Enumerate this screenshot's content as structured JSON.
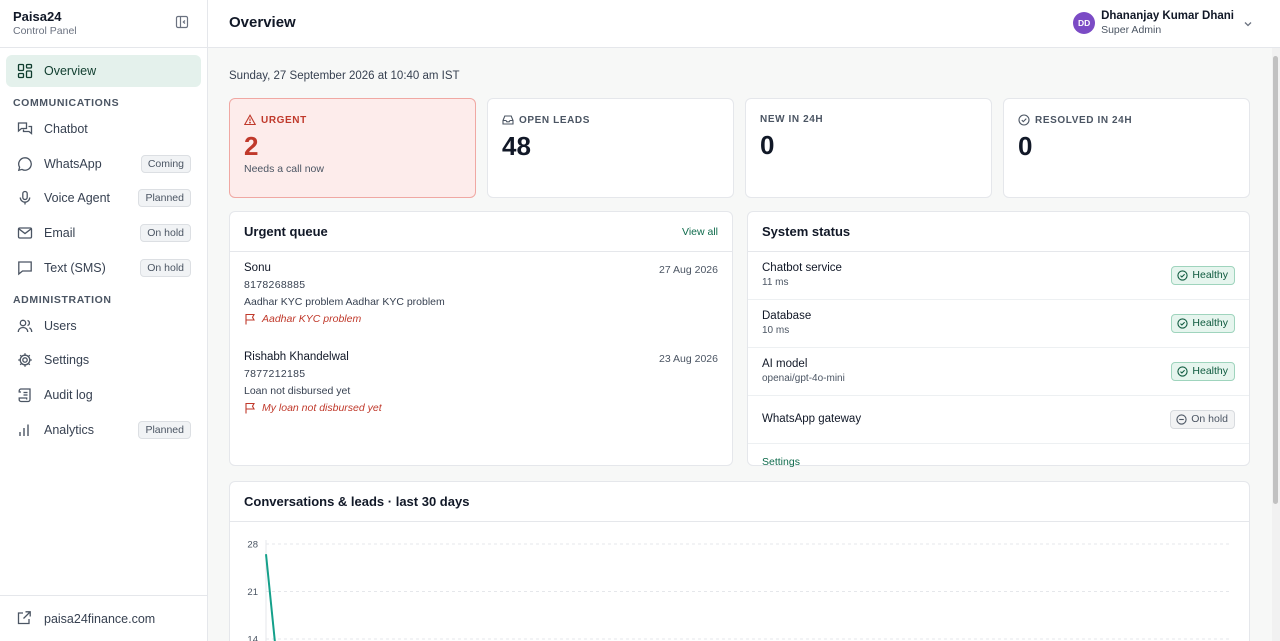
{
  "brand": {
    "name": "Paisa24",
    "subtitle": "Control Panel"
  },
  "sidebar": {
    "overview": "Overview",
    "sections": {
      "communications": "COMMUNICATIONS",
      "administration": "ADMINISTRATION"
    },
    "comm_items": [
      {
        "label": "Chatbot",
        "pill": ""
      },
      {
        "label": "WhatsApp",
        "pill": "Coming"
      },
      {
        "label": "Voice Agent",
        "pill": "Planned"
      },
      {
        "label": "Email",
        "pill": "On hold"
      },
      {
        "label": "Text (SMS)",
        "pill": "On hold"
      }
    ],
    "admin_items": [
      {
        "label": "Users",
        "pill": ""
      },
      {
        "label": "Settings",
        "pill": ""
      },
      {
        "label": "Audit log",
        "pill": ""
      },
      {
        "label": "Analytics",
        "pill": "Planned"
      }
    ],
    "footer_link": "paisa24finance.com"
  },
  "header": {
    "title": "Overview",
    "user": {
      "initials": "DD",
      "name": "Dhananjay Kumar Dhani",
      "role": "Super Admin"
    }
  },
  "date_line": "Sunday, 27 September 2026 at 10:40 am IST",
  "stats": [
    {
      "label": "URGENT",
      "value": "2",
      "sub": "Needs a call now"
    },
    {
      "label": "OPEN LEADS",
      "value": "48",
      "sub": ""
    },
    {
      "label": "NEW IN 24H",
      "value": "0",
      "sub": ""
    },
    {
      "label": "RESOLVED IN 24H",
      "value": "0",
      "sub": ""
    }
  ],
  "urgent_queue": {
    "title": "Urgent queue",
    "view_all": "View all",
    "items": [
      {
        "name": "Sonu",
        "date": "27 Aug 2026",
        "phone": "8178268885",
        "message": "Aadhar KYC problem Aadhar KYC problem",
        "flag": "Aadhar KYC problem"
      },
      {
        "name": "Rishabh Khandelwal",
        "date": "23 Aug 2026",
        "phone": "7877212185",
        "message": "Loan not disbursed yet",
        "flag": "My loan not disbursed yet"
      }
    ]
  },
  "system_status": {
    "title": "System status",
    "rows": [
      {
        "name": "Chatbot service",
        "detail": "11 ms",
        "status": "Healthy"
      },
      {
        "name": "Database",
        "detail": "10 ms",
        "status": "Healthy"
      },
      {
        "name": "AI model",
        "detail": "openai/gpt-4o-mini",
        "status": "Healthy"
      },
      {
        "name": "WhatsApp gateway",
        "detail": "",
        "status": "On hold"
      }
    ],
    "footer_link": "Settings"
  },
  "chart": {
    "title": "Conversations & leads · last 30 days"
  },
  "chart_data": {
    "type": "line",
    "title": "Conversations & leads · last 30 days",
    "y_ticks": [
      "28",
      "21",
      "14"
    ],
    "ylim": [
      0,
      28
    ],
    "grid": true,
    "series": [
      {
        "values": [
          26.5,
          12
        ]
      }
    ],
    "color": "#14a08a"
  },
  "colors": {
    "accent": "#0f6b4c",
    "urgent": "#c0392b",
    "active_bg": "#e4f1ec",
    "avatar": "#7b4bc5"
  }
}
